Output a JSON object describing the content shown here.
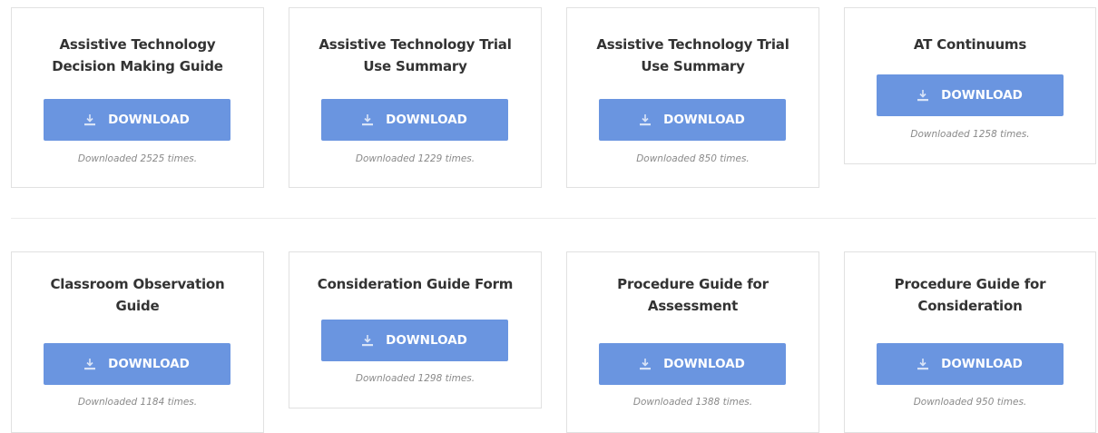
{
  "download_label": "DOWNLOAD",
  "colors": {
    "button": "#6a95e0",
    "card_border": "#e1e1e1",
    "title_text": "#333333",
    "count_text": "#8a8a8a"
  },
  "icons": {
    "download": "download-icon"
  },
  "row1": [
    {
      "title_line1": "Assistive Technology",
      "title_line2": "Decision Making Guide",
      "count": "Downloaded 2525 times."
    },
    {
      "title_line1": "Assistive Technology Trial",
      "title_line2": "Use Summary",
      "count": "Downloaded 1229 times."
    },
    {
      "title_line1": "Assistive Technology Trial",
      "title_line2": "Use Summary",
      "count": "Downloaded 850 times."
    },
    {
      "title_line1": "AT Continuums",
      "title_line2": "",
      "count": "Downloaded 1258 times."
    }
  ],
  "row2": [
    {
      "title_line1": "Classroom Observation",
      "title_line2": "Guide",
      "count": "Downloaded 1184 times."
    },
    {
      "title_line1": "Consideration Guide Form",
      "title_line2": "",
      "count": "Downloaded 1298 times."
    },
    {
      "title_line1": "Procedure Guide for",
      "title_line2": "Assessment",
      "count": "Downloaded 1388 times."
    },
    {
      "title_line1": "Procedure Guide for",
      "title_line2": "Consideration",
      "count": "Downloaded 950 times."
    }
  ]
}
